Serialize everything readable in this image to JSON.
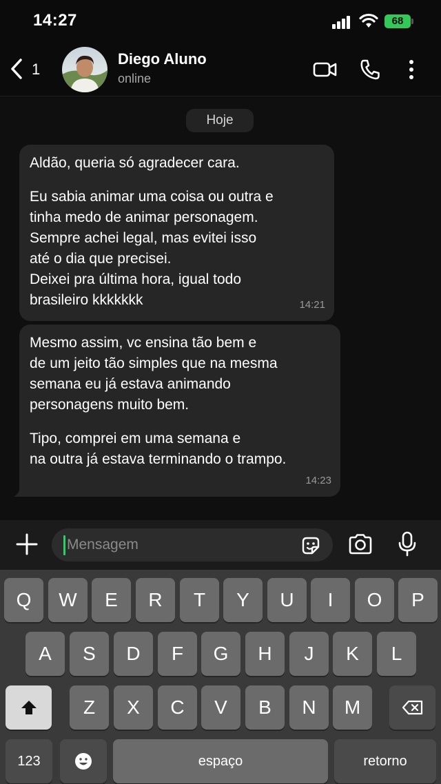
{
  "status_bar": {
    "time": "14:27",
    "battery": "68",
    "battery_color": "#34c759"
  },
  "header": {
    "back_count": "1",
    "contact_name": "Diego Aluno",
    "contact_status": "online",
    "icons": [
      "chevron-left-icon",
      "video-camera-icon",
      "phone-icon",
      "more-vertical-icon"
    ]
  },
  "chat": {
    "date_label": "Hoje",
    "messages": [
      {
        "direction": "incoming",
        "paragraphs": [
          "Aldão, queria só agradecer cara.",
          "Eu sabia animar uma coisa ou outra e\ntinha medo de animar personagem.\nSempre achei legal, mas evitei isso\naté o dia que precisei.\nDeixei pra última hora, igual todo\nbrasileiro kkkkkkk"
        ],
        "time": "14:21"
      },
      {
        "direction": "incoming",
        "paragraphs": [
          "Mesmo assim, vc ensina tão bem e\nde um jeito tão simples que na mesma\nsemana eu já estava animando\npersonagens muito bem.",
          "Tipo, comprei em uma semana e\nna outra já estava terminando o trampo."
        ],
        "time": "14:23"
      }
    ]
  },
  "composer": {
    "placeholder": "Mensagem",
    "icons": [
      "plus-icon",
      "sticker-icon",
      "camera-icon",
      "microphone-icon"
    ],
    "caret_color": "#25d366"
  },
  "keyboard": {
    "row1": [
      "Q",
      "W",
      "E",
      "R",
      "T",
      "Y",
      "U",
      "I",
      "O",
      "P"
    ],
    "row2": [
      "A",
      "S",
      "D",
      "F",
      "G",
      "H",
      "J",
      "K",
      "L"
    ],
    "row3": [
      "Z",
      "X",
      "C",
      "V",
      "B",
      "N",
      "M"
    ],
    "numbers_key": "123",
    "space_key": "espaço",
    "return_key": "retorno"
  }
}
